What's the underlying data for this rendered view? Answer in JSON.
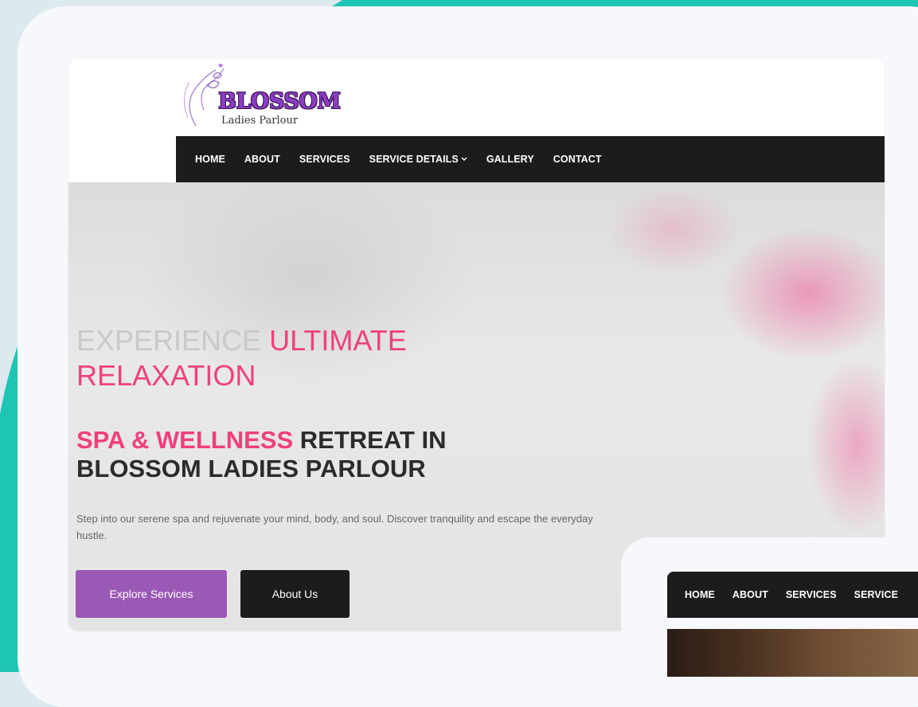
{
  "brand": {
    "title": "BLOSSOM",
    "subtitle": "Ladies Parlour"
  },
  "nav": {
    "items": [
      {
        "label": "HOME"
      },
      {
        "label": "ABOUT"
      },
      {
        "label": "SERVICES"
      },
      {
        "label": "SERVICE DETAILS",
        "has_dropdown": true
      },
      {
        "label": "GALLERY"
      },
      {
        "label": "CONTACT"
      }
    ]
  },
  "hero": {
    "heading_muted": "EXPERIENCE ",
    "heading_accent": "ULTIMATE RELAXATION",
    "sub_accent": "SPA & WELLNESS",
    "sub_rest": " RETREAT IN BLOSSOM LADIES PARLOUR",
    "description": "Step into our serene spa and rejuvenate your mind, body, and soul. Discover tranquility and escape the everyday hustle.",
    "primary_button": "Explore Services",
    "secondary_button": "About Us"
  },
  "preview": {
    "nav_items": [
      "HOME",
      "ABOUT",
      "SERVICES",
      "SERVICE"
    ]
  },
  "colors": {
    "teal": "#1ec4b4",
    "accent_pink": "#f03f7e",
    "button_purple": "#9b59b6",
    "nav_dark": "#1c1c1c"
  }
}
